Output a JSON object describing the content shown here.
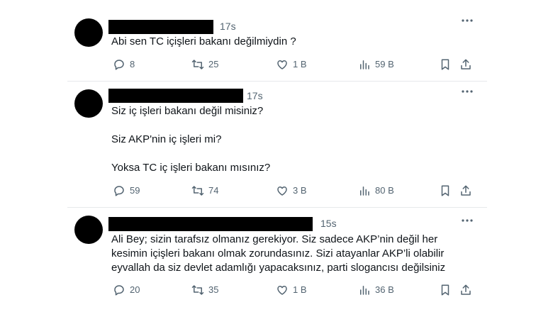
{
  "icons": {
    "reply": "reply-icon",
    "retweet": "retweet-icon",
    "like": "heart-icon",
    "views": "views-chart-icon",
    "bookmark": "bookmark-icon",
    "share": "share-icon",
    "more": "more-dots-icon"
  },
  "tweets": [
    {
      "time": "17s",
      "lines": [
        "Abi sen TC içişleri bakanı değilmiydin ?"
      ],
      "replies": "8",
      "retweets": "25",
      "likes": "1 B",
      "views": "59 B"
    },
    {
      "time": "17s",
      "lines": [
        "Siz iç işleri bakanı değil misiniz?",
        "Siz AKP'nin iç işleri mi?",
        "Yoksa TC iç işleri bakanı mısınız?"
      ],
      "replies": "59",
      "retweets": "74",
      "likes": "3 B",
      "views": "80 B"
    },
    {
      "time": "15s",
      "lines": [
        "Ali Bey; sizin tarafsız olmanız gerekiyor. Siz sadece AKP’nin değil her",
        "kesimin içişleri bakanı olmak zorundasınız. Sizi atayanlar AKP’li olabilir",
        "eyvallah da siz devlet adamlığı yapacaksınız, parti slogancısı değilsiniz"
      ],
      "replies": "20",
      "retweets": "35",
      "likes": "1 B",
      "views": "36 B"
    }
  ]
}
